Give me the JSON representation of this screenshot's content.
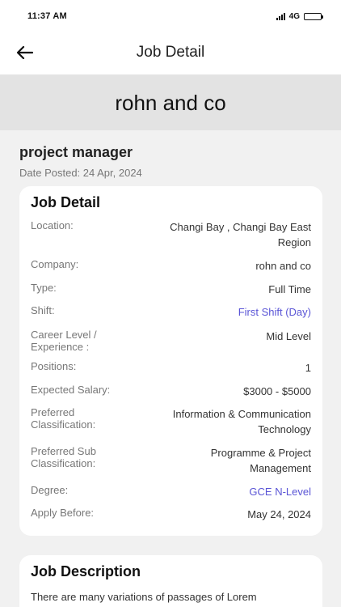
{
  "status_bar": {
    "time": "11:37 AM",
    "network": "4G"
  },
  "header": {
    "title": "Job Detail"
  },
  "company": {
    "name": "rohn and co"
  },
  "job": {
    "title": "project manager",
    "date_posted": "Date Posted: 24 Apr, 2024"
  },
  "detail_card": {
    "title": "Job Detail",
    "rows": [
      {
        "label": "Location:",
        "value": "Changi Bay , Changi Bay East Region"
      },
      {
        "label": "Company:",
        "value": "rohn and co"
      },
      {
        "label": "Type:",
        "value": "Full Time"
      },
      {
        "label": "Shift:",
        "value": "First Shift (Day)"
      },
      {
        "label": "Career Level / Experience :",
        "value": "Mid Level"
      },
      {
        "label": "Positions:",
        "value": "1"
      },
      {
        "label": "Expected Salary:",
        "value": "$3000 - $5000"
      },
      {
        "label": "Preferred Classification:",
        "value": "Information & Communication Technology"
      },
      {
        "label": "Preferred Sub Classification:",
        "value": "Programme & Project Management"
      },
      {
        "label": "Degree:",
        "value": "GCE N-Level"
      },
      {
        "label": "Apply Before:",
        "value": "May 24, 2024"
      }
    ]
  },
  "description_card": {
    "title": "Job Description",
    "text": "There are many variations of passages of Lorem"
  },
  "colors": {
    "link": "#5a55d6",
    "banner": "#e3e3e3",
    "background": "#f1f1f1"
  }
}
